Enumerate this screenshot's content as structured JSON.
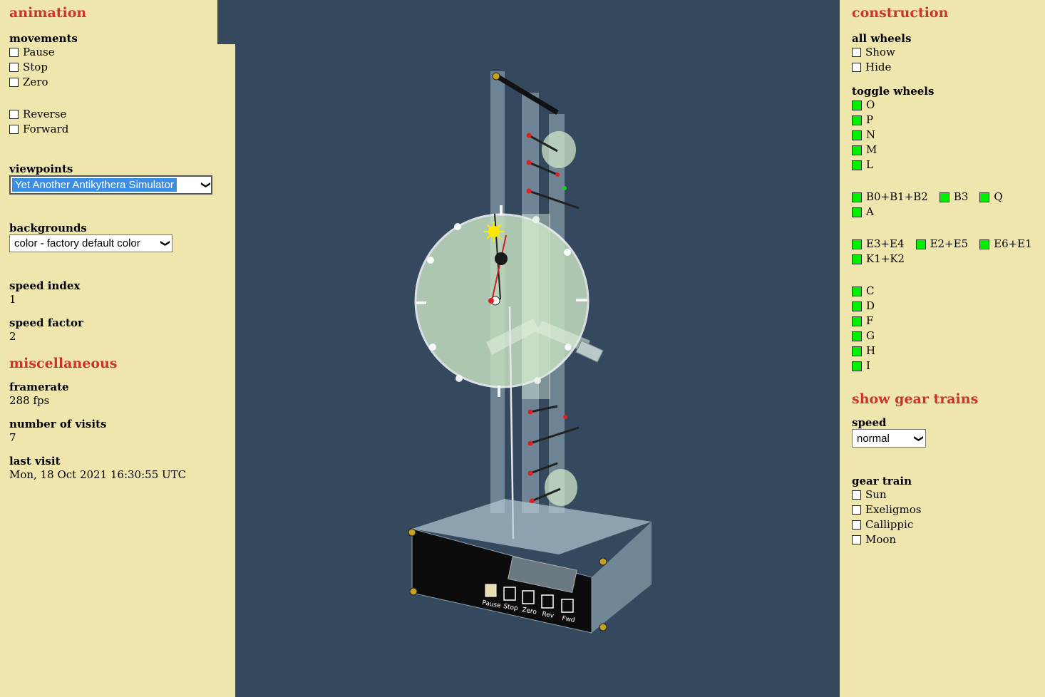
{
  "colors": {
    "panel": "#efe6ad",
    "heading": "#c9342d",
    "viewport": "#34495e",
    "toggle_on": "#00ee00",
    "select_highlight": "#3a8ee6"
  },
  "left": {
    "animation": {
      "heading": "animation",
      "movements_label": "movements",
      "movements": [
        "Pause",
        "Stop",
        "Zero"
      ],
      "direction": [
        "Reverse",
        "Forward"
      ],
      "viewpoints_label": "viewpoints",
      "viewpoint_selected": "Yet Another Antikythera Simulator",
      "backgrounds_label": "backgrounds",
      "background_selected": "color - factory default color",
      "speed_index_label": "speed index",
      "speed_index": "1",
      "speed_factor_label": "speed factor",
      "speed_factor": "2"
    },
    "misc": {
      "heading": "miscellaneous",
      "framerate_label": "framerate",
      "framerate": "288 fps",
      "visits_label": "number of visits",
      "visits": "7",
      "last_visit_label": "last visit",
      "last_visit": "Mon, 18 Oct 2021 16:30:55 UTC"
    }
  },
  "right": {
    "construction": {
      "heading": "construction",
      "all_wheels_label": "all wheels",
      "all_wheels": [
        "Show",
        "Hide"
      ],
      "toggle_label": "toggle wheels",
      "group1": [
        "O",
        "P",
        "N",
        "M",
        "L"
      ],
      "group2": [
        "B0+B1+B2",
        "B3",
        "Q",
        "A"
      ],
      "group3": [
        "E3+E4",
        "E2+E5",
        "E6+E1",
        "K1+K2"
      ],
      "group4": [
        "C",
        "D",
        "F",
        "G",
        "H",
        "I"
      ]
    },
    "gear": {
      "heading": "show gear trains",
      "speed_label": "speed",
      "speed_selected": "normal",
      "train_label": "gear train",
      "trains": [
        "Sun",
        "Exeligmos",
        "Callippic",
        "Moon"
      ]
    }
  },
  "device": {
    "buttons": [
      "Pause",
      "Stop",
      "Zero",
      "Rev",
      "Fwd"
    ]
  },
  "icons": {
    "dropdown": "chevron-down-icon",
    "sun": "sun-icon"
  }
}
